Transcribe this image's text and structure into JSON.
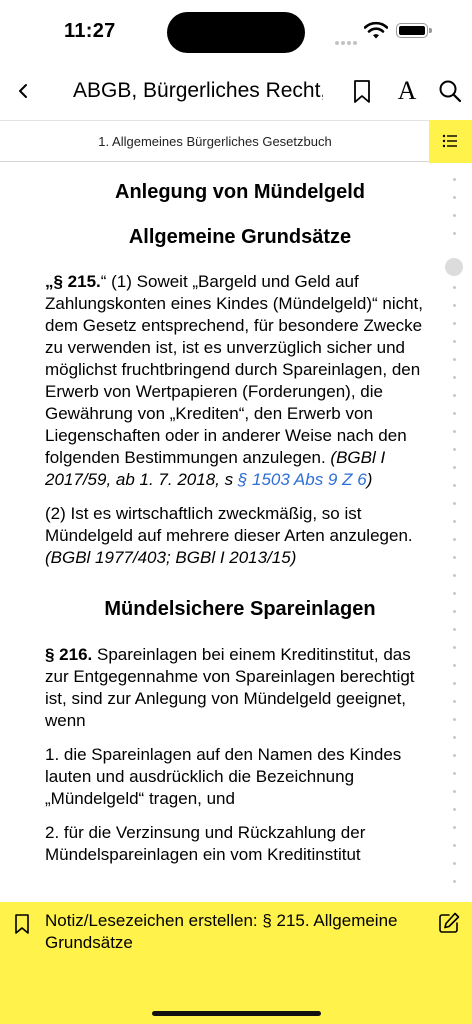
{
  "status": {
    "time": "11:27"
  },
  "nav": {
    "title": "ABGB, Bürgerliches Recht,",
    "font_label": "A"
  },
  "subheader": {
    "title": "1. Allgemeines Bürgerliches Gesetzbuch"
  },
  "content": {
    "heading1": "Anlegung von Mündelgeld",
    "heading2": "Allgemeine Grundsätze",
    "p215": {
      "lead": "„§ 215.",
      "text": "“ (1) Soweit „Bargeld und Geld auf Zahlungskonten eines Kindes (Mündelgeld)“ nicht, dem Gesetz entsprechend, für besondere Zwecke zu verwenden ist, ist es unverzüglich sicher und möglichst fruchtbringend durch Spareinlagen, den Erwerb von Wertpapieren (Forderungen), die Gewährung von „Krediten“, den Erwerb von Liegenschaften oder in anderer Weise nach den folgenden Bestimmungen anzulegen.",
      "citation": " (BGBl I 2017/59, ab 1. 7. 2018, s ",
      "link": "§ 1503 Abs 9 Z 6",
      "citation_end": ")"
    },
    "p215_2": "(2) Ist es wirtschaftlich zweckmäßig, so ist Mündelgeld auf mehrere dieser Arten anzulegen.",
    "p215_2_citation": "(BGBl 1977/403; BGBl I 2013/15)",
    "heading3": "Mündelsichere Spareinlagen",
    "p216": {
      "lead": "§ 216.",
      "text": " Spareinlagen bei einem Kreditinstitut, das zur Entgegennahme von Spareinlagen berechtigt ist, sind zur Anlegung von Mündelgeld geeignet, wenn"
    },
    "item1": "1. die Spareinlagen auf den Namen des Kindes lauten und ausdrücklich die Bezeichnung „Mündelgeld“ tragen, und",
    "item2": "2. für die Verzinsung und Rückzahlung der Mündelspareinlagen ein vom Kreditinstitut"
  },
  "note_bar": {
    "text": "Notiz/Lesezeichen erstellen: § 215. Allgemeine Grundsätze"
  },
  "colors": {
    "accent": "#fff24a",
    "link": "#2f6fd6"
  },
  "icons": [
    "back-chevron-icon",
    "bookmark-icon",
    "font-size-icon",
    "search-icon",
    "list-icon",
    "edit-icon",
    "wifi-icon",
    "battery-icon"
  ]
}
